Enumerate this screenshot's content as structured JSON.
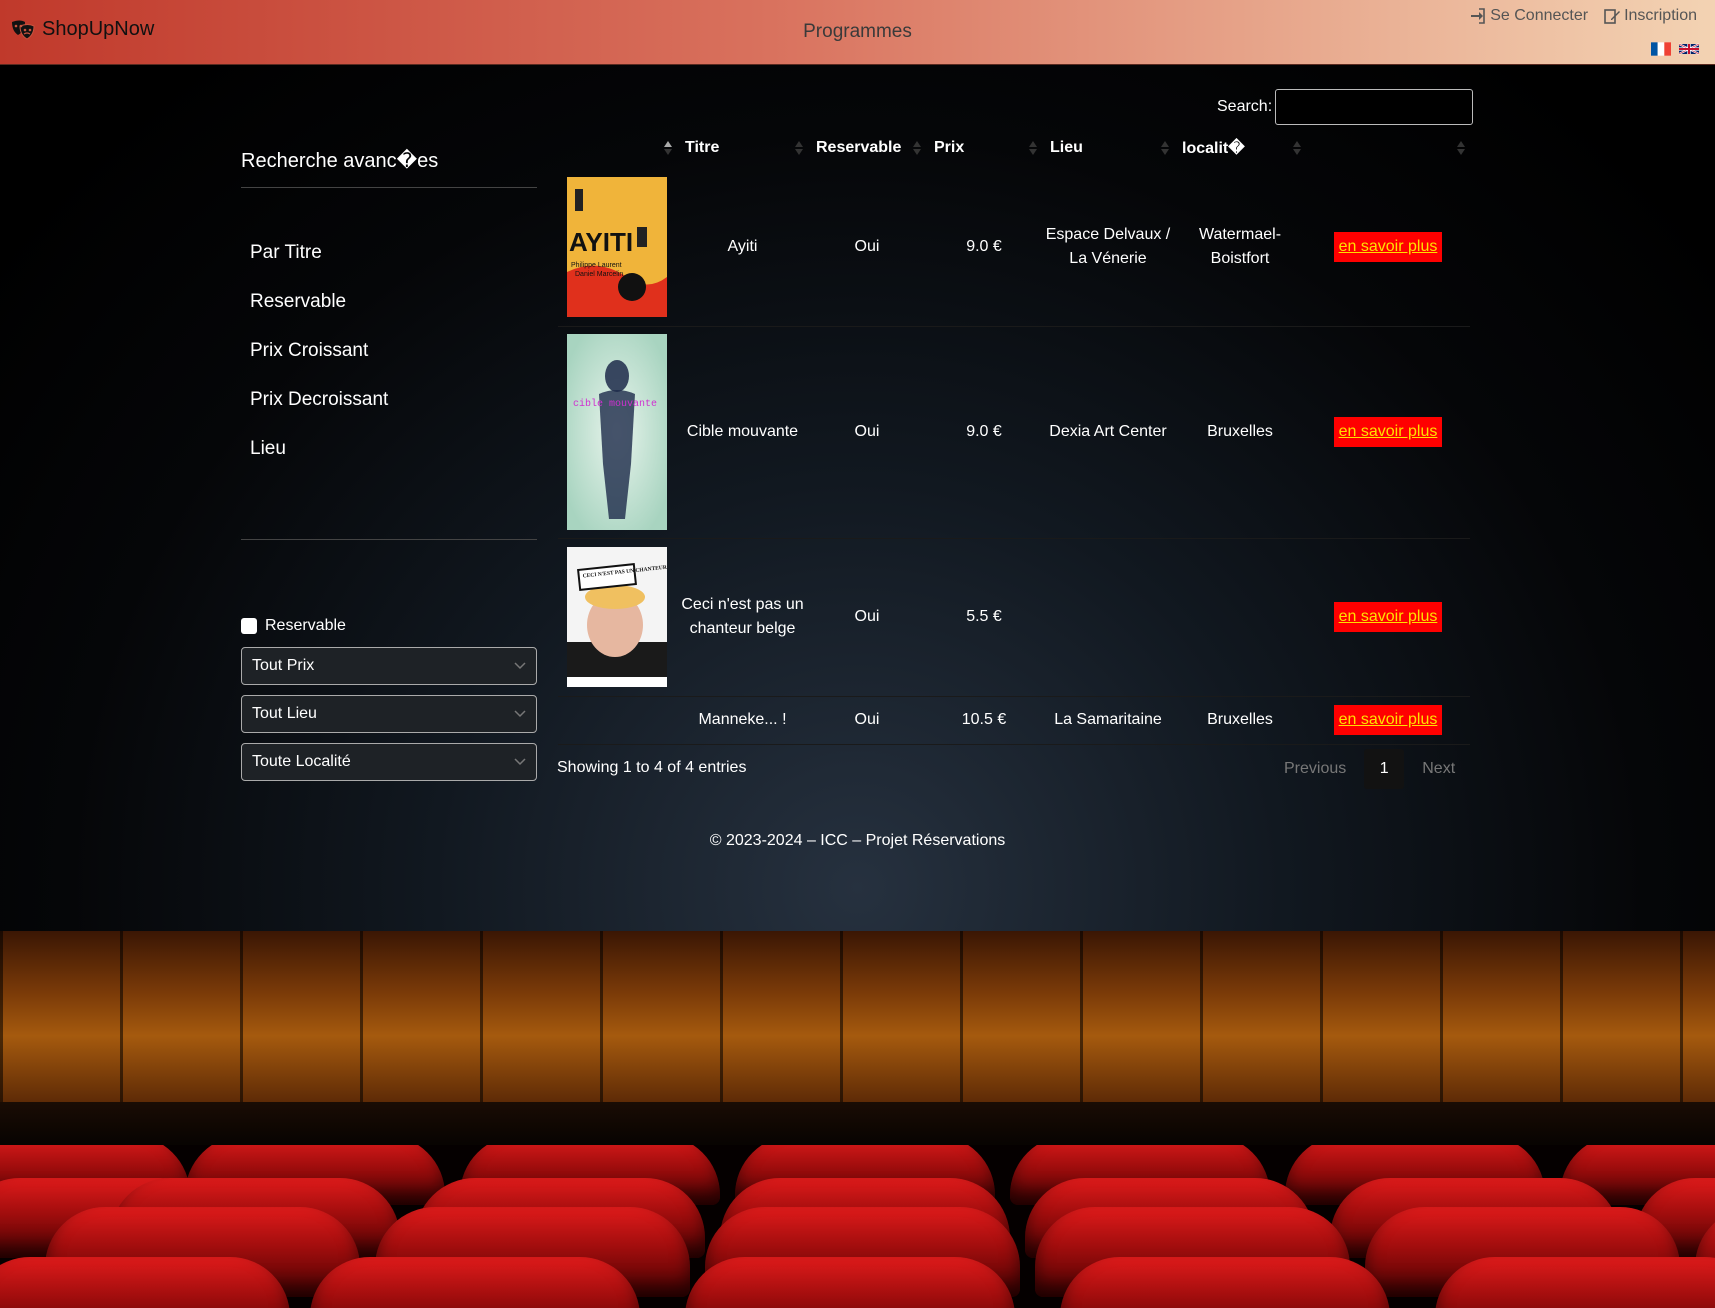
{
  "nav": {
    "brand": "ShopUpNow",
    "center_title": "Programmes",
    "login": "Se Connecter",
    "register": "Inscription",
    "flags": [
      "fr-flag",
      "en-flag"
    ]
  },
  "search": {
    "label": "Search:",
    "value": ""
  },
  "sidebar": {
    "title": "Recherche avanc�es",
    "items": [
      "Par Titre",
      "Reservable",
      "Prix Croissant",
      "Prix Decroissant",
      "Lieu"
    ],
    "checkbox_label": "Reservable",
    "checkbox_checked": false,
    "selects": [
      "Tout Prix",
      "Tout Lieu",
      "Toute Localité"
    ]
  },
  "table": {
    "headers": [
      "",
      "Titre",
      "Reservable",
      "Prix",
      "Lieu",
      "localit�",
      ""
    ],
    "sorted_column": "",
    "rows": [
      {
        "title": "Ayiti",
        "reservable": "Oui",
        "prix": "9.0 €",
        "lieu": "Espace Delvaux / La Vénerie",
        "localite": "Watermael-Boistfort",
        "action": "en savoir plus",
        "poster_text": "AYITI"
      },
      {
        "title": "Cible mouvante",
        "reservable": "Oui",
        "prix": "9.0 €",
        "lieu": "Dexia Art Center",
        "localite": "Bruxelles",
        "action": "en savoir plus",
        "poster_text": "cible mouvante"
      },
      {
        "title": "Ceci n'est pas un chanteur belge",
        "reservable": "Oui",
        "prix": "5.5 €",
        "lieu": "",
        "localite": "",
        "action": "en savoir plus",
        "poster_text": "CECI N'EST PAS UN CHANTEUR BELGE"
      },
      {
        "title": "Manneke... !",
        "reservable": "Oui",
        "prix": "10.5 €",
        "lieu": "La Samaritaine",
        "localite": "Bruxelles",
        "action": "en savoir plus",
        "poster_text": ""
      }
    ]
  },
  "info": "Showing 1 to 4 of 4 entries",
  "pager": {
    "previous": "Previous",
    "current": "1",
    "next": "Next"
  },
  "footer": "© 2023-2024 – ICC – Projet Réservations",
  "colors": {
    "accent": "#ff0000",
    "link": "#ffe000",
    "nav_start": "#c0392b",
    "nav_end": "#f3d3b3"
  }
}
